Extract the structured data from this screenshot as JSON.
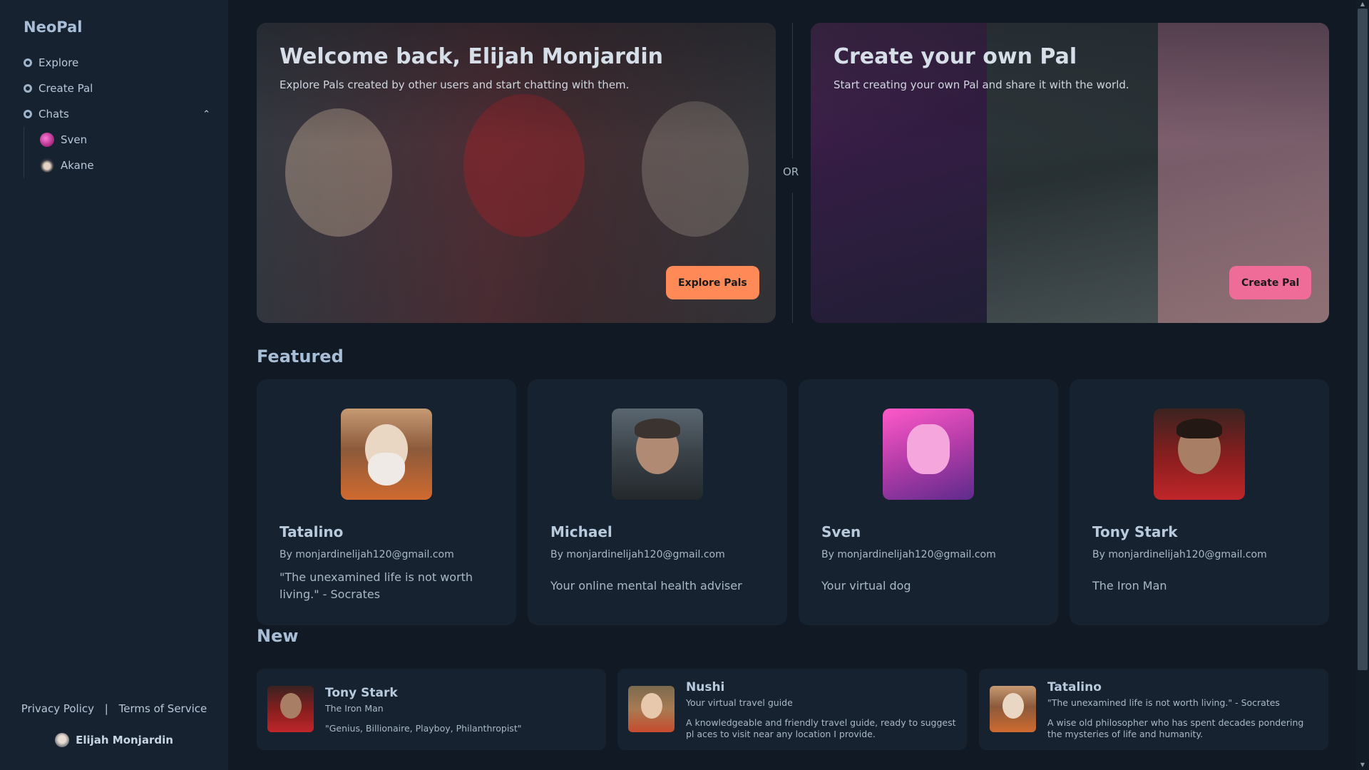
{
  "sidebar": {
    "brand": "NeoPal",
    "nav": [
      {
        "label": "Explore",
        "icon": "explore-icon"
      },
      {
        "label": "Create Pal",
        "icon": "create-icon"
      },
      {
        "label": "Chats",
        "icon": "chats-icon"
      }
    ],
    "chats": [
      {
        "label": "Sven"
      },
      {
        "label": "Akane"
      }
    ],
    "footer": {
      "privacy": "Privacy Policy",
      "separator": "|",
      "terms": "Terms of Service"
    },
    "user": {
      "name": "Elijah Monjardin"
    }
  },
  "hero": {
    "left": {
      "title": "Welcome back, Elijah Monjardin",
      "subtitle": "Explore Pals created by other users and start chatting with them.",
      "button": "Explore Pals"
    },
    "or": "OR",
    "right": {
      "title": "Create your own Pal",
      "subtitle": "Start creating your own Pal and share it with the world.",
      "button": "Create Pal"
    }
  },
  "featured": {
    "title": "Featured",
    "cards": [
      {
        "name": "Tatalino",
        "by": "By monjardinelijah120@gmail.com",
        "desc": "\"The unexamined life is not worth living.\" - Socrates"
      },
      {
        "name": "Michael",
        "by": "By monjardinelijah120@gmail.com",
        "desc": "Your online mental health adviser"
      },
      {
        "name": "Sven",
        "by": "By monjardinelijah120@gmail.com",
        "desc": "Your virtual dog"
      },
      {
        "name": "Tony Stark",
        "by": "By monjardinelijah120@gmail.com",
        "desc": "The Iron Man"
      }
    ]
  },
  "new": {
    "title": "New",
    "cards": [
      {
        "name": "Tony Stark",
        "tagline": "The Iron Man",
        "desc": "\"Genius, Billionaire, Playboy, Philanthropist\""
      },
      {
        "name": "Nushi",
        "tagline": "Your virtual travel guide",
        "desc": "A knowledgeable and friendly travel guide, ready to suggest pl aces to visit near any location I provide."
      },
      {
        "name": "Tatalino",
        "tagline": "\"The unexamined life is not worth living.\" - Socrates",
        "desc": "A wise old philosopher who has spent decades pondering the mysteries of life and humanity."
      }
    ]
  }
}
